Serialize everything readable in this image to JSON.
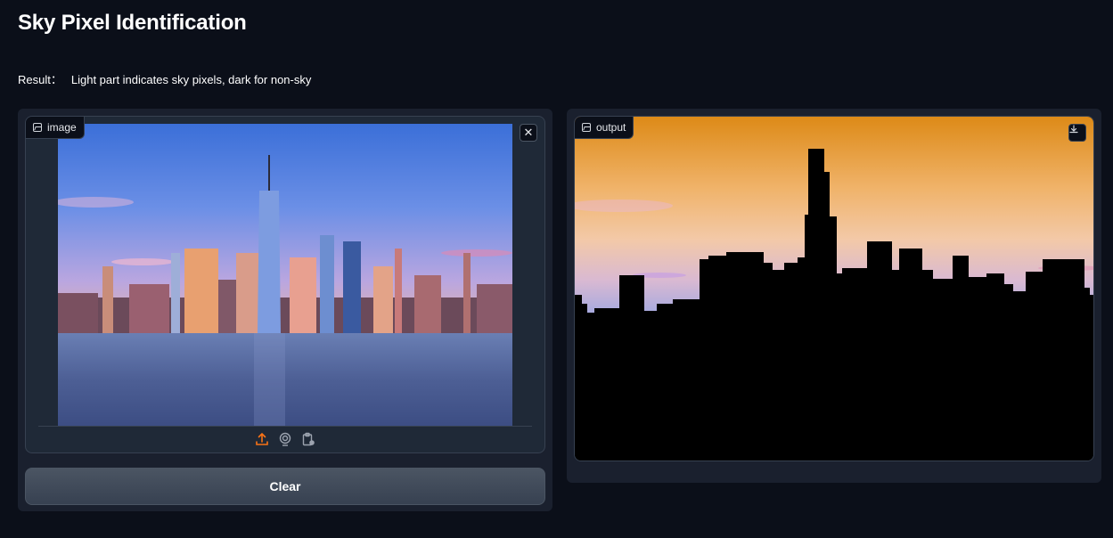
{
  "app": {
    "title": "Sky Pixel Identification",
    "result_label": "Result：",
    "result_text": "Light part indicates sky pixels, dark for non-sky"
  },
  "input": {
    "label": "image",
    "close_symbol": "✕",
    "icons": [
      "upload-icon",
      "webcam-icon",
      "clipboard-icon"
    ],
    "accent": "#f97316"
  },
  "output": {
    "label": "output",
    "icons": [
      "download-icon"
    ]
  },
  "buttons": {
    "clear": "Clear"
  },
  "colors": {
    "background": "#0b0f19",
    "panel": "#1a202e",
    "border": "#374151"
  }
}
